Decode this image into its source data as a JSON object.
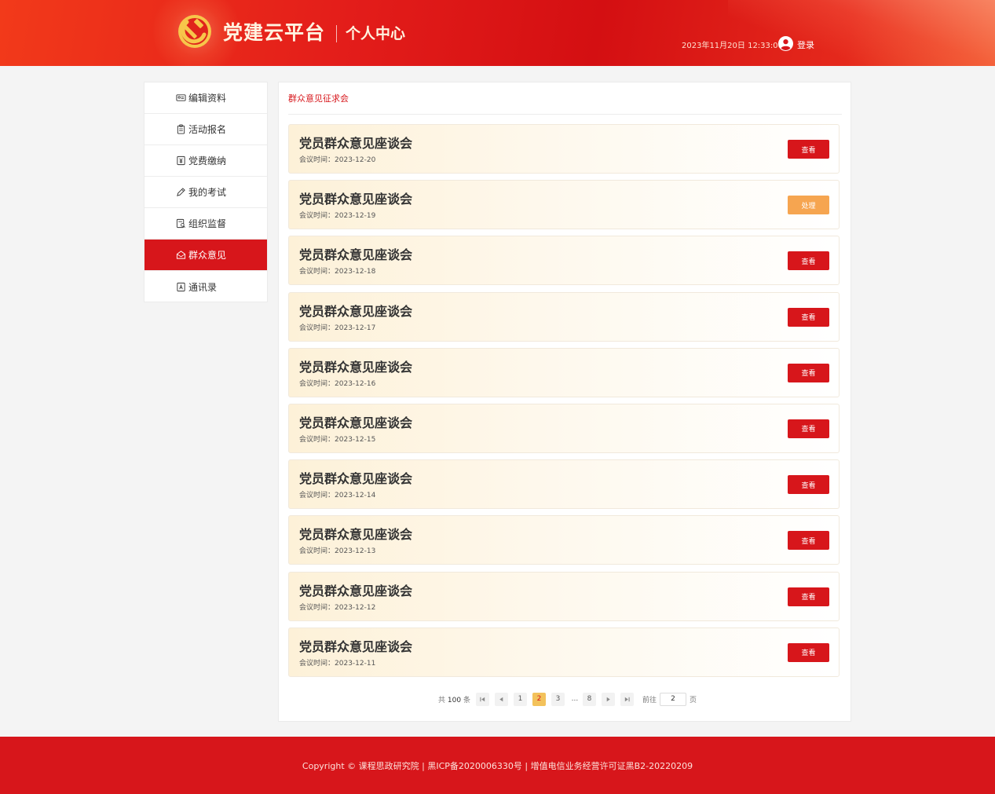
{
  "header": {
    "platform_name": "党建云平台",
    "center_name": "个人中心",
    "datetime": "2023年11月20日 12:33:00",
    "login_label": "登录"
  },
  "sidebar": {
    "items": [
      {
        "label": "编辑资料",
        "icon": "id-card-icon"
      },
      {
        "label": "活动报名",
        "icon": "clipboard-icon"
      },
      {
        "label": "党费缴纳",
        "icon": "yuan-doc-icon"
      },
      {
        "label": "我的考试",
        "icon": "pen-icon"
      },
      {
        "label": "组织监督",
        "icon": "doc-search-icon"
      },
      {
        "label": "群众意见",
        "icon": "mail-icon",
        "active": true
      },
      {
        "label": "通讯录",
        "icon": "contact-book-icon"
      }
    ]
  },
  "main": {
    "breadcrumb": "群众意见征求会",
    "date_prefix": "会议时间：",
    "cards": [
      {
        "title": "党员群众意见座谈会",
        "date": "2023-12-20",
        "action": "查看",
        "action_type": "view"
      },
      {
        "title": "党员群众意见座谈会",
        "date": "2023-12-19",
        "action": "处理",
        "action_type": "handle"
      },
      {
        "title": "党员群众意见座谈会",
        "date": "2023-12-18",
        "action": "查看",
        "action_type": "view"
      },
      {
        "title": "党员群众意见座谈会",
        "date": "2023-12-17",
        "action": "查看",
        "action_type": "view"
      },
      {
        "title": "党员群众意见座谈会",
        "date": "2023-12-16",
        "action": "查看",
        "action_type": "view"
      },
      {
        "title": "党员群众意见座谈会",
        "date": "2023-12-15",
        "action": "查看",
        "action_type": "view"
      },
      {
        "title": "党员群众意见座谈会",
        "date": "2023-12-14",
        "action": "查看",
        "action_type": "view"
      },
      {
        "title": "党员群众意见座谈会",
        "date": "2023-12-13",
        "action": "查看",
        "action_type": "view"
      },
      {
        "title": "党员群众意见座谈会",
        "date": "2023-12-12",
        "action": "查看",
        "action_type": "view"
      },
      {
        "title": "党员群众意见座谈会",
        "date": "2023-12-11",
        "action": "查看",
        "action_type": "view"
      }
    ]
  },
  "pagination": {
    "total_prefix": "共",
    "total": "100",
    "total_suffix": "条",
    "pages": [
      "1",
      "2",
      "3",
      "...",
      "8"
    ],
    "current": "2",
    "goto_label": "前往",
    "goto_value": "2",
    "page_unit": "页"
  },
  "footer": {
    "text": "Copyright © 课程思政研究院 | 黑ICP备2020006330号 | 增值电信业务经营许可证黑B2-20220209"
  },
  "colors": {
    "brand_red": "#d7161b",
    "handle_orange": "#f6a550",
    "current_page": "#f3c25b"
  }
}
